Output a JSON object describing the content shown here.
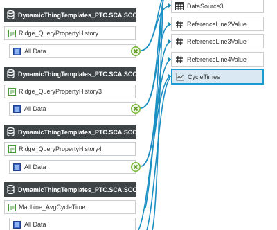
{
  "colors": {
    "header_bg": "#3f4547",
    "wire": "#1c8fc2",
    "link_green": "#7bb93c",
    "selected_border": "#1b9ad1",
    "selected_bg": "#d9e8f2"
  },
  "data_sources": [
    {
      "header": "DynamicThingTemplates_PTC.SCA.SCO.K...",
      "service": "Ridge_QueryPropertyHistory",
      "data_label": "All Data"
    },
    {
      "header": "DynamicThingTemplates_PTC.SCA.SCO.K...",
      "service": "Ridge_QueryPropertyHistory3",
      "data_label": "All Data"
    },
    {
      "header": "DynamicThingTemplates_PTC.SCA.SCO.K...",
      "service": "Ridge_QueryPropertyHistory4",
      "data_label": "All Data"
    },
    {
      "header": "DynamicThingTemplates_PTC.SCA.SCO.K...",
      "service": "Machine_AvgCycleTime",
      "data_label": "All Data"
    }
  ],
  "targets": [
    {
      "label": "DataSource3",
      "icon": "table-icon"
    },
    {
      "label": "ReferenceLine2Value",
      "icon": "hash-icon"
    },
    {
      "label": "ReferenceLine3Value",
      "icon": "hash-icon"
    },
    {
      "label": "ReferenceLine4Value",
      "icon": "hash-icon"
    },
    {
      "label": "CycleTimes",
      "icon": "line-chart-icon",
      "selected": true
    }
  ]
}
